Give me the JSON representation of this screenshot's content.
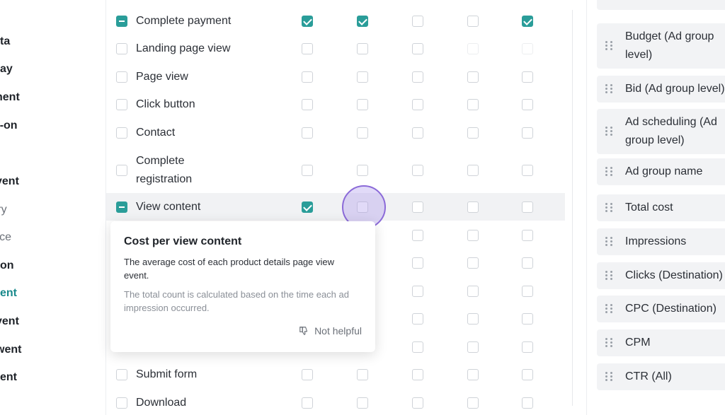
{
  "left_nav": [
    {
      "text": "ta",
      "style": "bold"
    },
    {
      "text": "ay",
      "style": "bold"
    },
    {
      "text": "nent",
      "style": "bold"
    },
    {
      "text": "ve add-on",
      "style": "bold"
    },
    {
      "text": "vent",
      "style": "bold"
    },
    {
      "text": "c Type: Every",
      "style": "gray"
    },
    {
      "text": "c Type: Once",
      "style": "gray"
    },
    {
      "text": "on",
      "style": "bold"
    },
    {
      "text": "ent",
      "style": "teal"
    },
    {
      "text": "vent",
      "style": "bold"
    },
    {
      "text": "went",
      "style": "bold"
    },
    {
      "text": "ent",
      "style": "bold"
    }
  ],
  "event_rows": [
    {
      "label": "Complete payment",
      "selection": "partial",
      "checks": [
        "checked",
        "checked",
        "unchecked",
        "unchecked",
        "checked"
      ]
    },
    {
      "label": "Landing page view",
      "selection": "unchecked",
      "checks": [
        "unchecked",
        "unchecked",
        "unchecked",
        "disabled",
        "disabled"
      ]
    },
    {
      "label": "Page view",
      "selection": "unchecked",
      "checks": [
        "unchecked",
        "unchecked",
        "unchecked",
        "unchecked",
        "unchecked"
      ]
    },
    {
      "label": "Click button",
      "selection": "unchecked",
      "checks": [
        "unchecked",
        "unchecked",
        "unchecked",
        "unchecked",
        "unchecked"
      ]
    },
    {
      "label": "Contact",
      "selection": "unchecked",
      "checks": [
        "unchecked",
        "unchecked",
        "unchecked",
        "unchecked",
        "unchecked"
      ]
    },
    {
      "label": "Complete\nregistration",
      "selection": "unchecked",
      "checks": [
        "unchecked",
        "unchecked",
        "unchecked",
        "unchecked",
        "unchecked"
      ]
    },
    {
      "label": "View content",
      "selection": "partial",
      "checks": [
        "checked",
        "unchecked",
        "unchecked",
        "unchecked",
        "unchecked"
      ],
      "highlighted": true
    },
    {
      "label": "",
      "selection": "hidden",
      "checks": [
        "hidden",
        "hidden",
        "unchecked",
        "unchecked",
        "unchecked"
      ]
    },
    {
      "label": "",
      "selection": "hidden",
      "checks": [
        "hidden",
        "hidden",
        "unchecked",
        "unchecked",
        "unchecked"
      ]
    },
    {
      "label": "",
      "selection": "hidden",
      "checks": [
        "hidden",
        "hidden",
        "unchecked",
        "unchecked",
        "unchecked"
      ]
    },
    {
      "label": "",
      "selection": "hidden",
      "checks": [
        "hidden",
        "hidden",
        "unchecked",
        "unchecked",
        "unchecked"
      ]
    },
    {
      "label": "",
      "selection": "hidden",
      "checks": [
        "hidden",
        "hidden",
        "unchecked",
        "unchecked",
        "unchecked"
      ]
    },
    {
      "label": "Submit form",
      "selection": "unchecked",
      "checks": [
        "unchecked",
        "unchecked",
        "unchecked",
        "unchecked",
        "unchecked"
      ]
    },
    {
      "label": "Download",
      "selection": "unchecked",
      "checks": [
        "unchecked",
        "unchecked",
        "unchecked",
        "unchecked",
        "unchecked"
      ]
    }
  ],
  "tooltip": {
    "title": "Cost per view content",
    "description": "The average cost of each product details page view event.",
    "note": "The total count is calculated based on the time each ad impression occurred.",
    "feedback_label": "Not helpful",
    "feedback_icon": "thumbs-down-icon"
  },
  "selected_metrics": [
    {
      "label": "Budget (Ad group\nlevel)"
    },
    {
      "label": "Bid (Ad group level)"
    },
    {
      "label": "Ad scheduling (Ad\ngroup level)"
    },
    {
      "label": "Ad group name"
    },
    {
      "label": "Total cost"
    },
    {
      "label": "Impressions"
    },
    {
      "label": "Clicks (Destination)"
    },
    {
      "label": "CPC (Destination)"
    },
    {
      "label": "CPM"
    },
    {
      "label": "CTR (All)"
    }
  ],
  "colors": {
    "accent": "#2a9d99",
    "link": "#1a8a8c",
    "cursor": "#8b6ad8"
  }
}
